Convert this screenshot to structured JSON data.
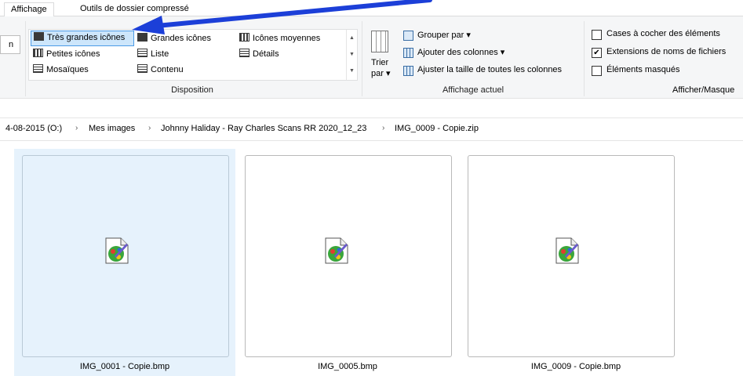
{
  "tabs": [
    "Affichage",
    "Outils de dossier compressé"
  ],
  "ribbon": {
    "left_cut_label": "n",
    "layout_items": [
      {
        "label": "Très grandes icônes",
        "selected": true
      },
      {
        "label": "Grandes icônes"
      },
      {
        "label": "Icônes moyennes"
      },
      {
        "label": "Petites icônes"
      },
      {
        "label": "Liste"
      },
      {
        "label": "Détails"
      },
      {
        "label": "Mosaïques"
      },
      {
        "label": "Contenu"
      }
    ],
    "layout_group_label": "Disposition",
    "sort_label_1": "Trier",
    "sort_label_2": "par ▾",
    "group_by": "Grouper par ▾",
    "add_columns": "Ajouter des colonnes ▾",
    "fit_columns": "Ajuster la taille de toutes les colonnes",
    "current_view_group_label": "Affichage actuel",
    "checkboxes": [
      {
        "label": "Cases à cocher des éléments",
        "checked": false
      },
      {
        "label": "Extensions de noms de fichiers",
        "checked": true
      },
      {
        "label": "Éléments masqués",
        "checked": false
      }
    ],
    "show_hide_group_label": "Afficher/Masque"
  },
  "address": {
    "crumbs": [
      "4-08-2015 (O:)",
      "Mes images",
      "Johnny Haliday - Ray Charles Scans RR 2020_12_23",
      "IMG_0009 - Copie.zip"
    ],
    "separator": "›"
  },
  "files": [
    {
      "name": "IMG_0001 - Copie.bmp",
      "selected": true
    },
    {
      "name": "IMG_0005.bmp"
    },
    {
      "name": "IMG_0009 - Copie.bmp"
    }
  ],
  "colors": {
    "arrow": "#1c3fd8",
    "selection": "#cde6fb",
    "tile_selected": "#e6f2fc"
  }
}
